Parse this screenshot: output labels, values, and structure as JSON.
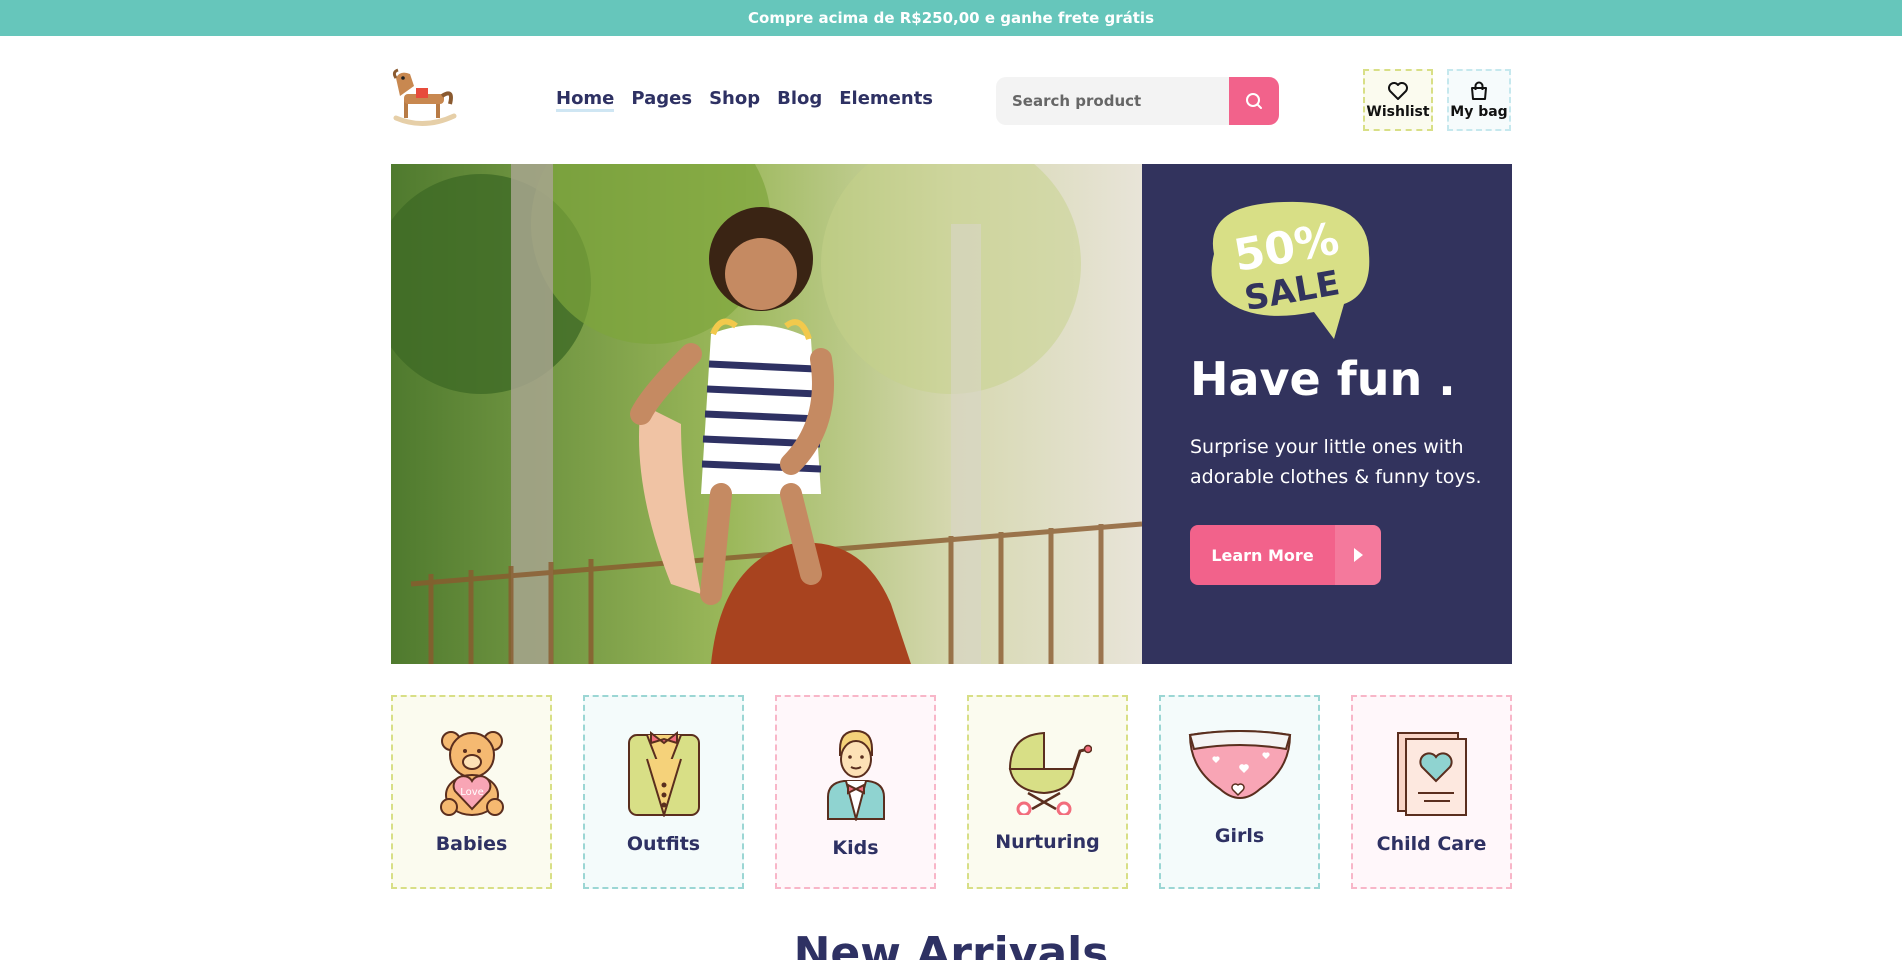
{
  "topbar": {
    "text": "Compre acima de R$250,00 e ganhe frete grátis"
  },
  "nav": {
    "items": [
      {
        "label": "Home"
      },
      {
        "label": "Pages"
      },
      {
        "label": "Shop"
      },
      {
        "label": "Blog"
      },
      {
        "label": "Elements"
      }
    ],
    "active": "Home"
  },
  "search": {
    "placeholder": "Search product"
  },
  "header_actions": {
    "wishlist": "Wishlist",
    "bag": "My bag"
  },
  "hero": {
    "badge_line1": "50%",
    "badge_line2": "SALE",
    "title": "Have fun .",
    "description": "Surprise your little ones with adorable clothes & funny toys.",
    "button": "Learn More"
  },
  "categories": [
    {
      "label": "Babies",
      "icon": "teddy-bear-icon",
      "badge": "Love"
    },
    {
      "label": "Outfits",
      "icon": "vest-icon"
    },
    {
      "label": "Kids",
      "icon": "boy-icon"
    },
    {
      "label": "Nurturing",
      "icon": "stroller-icon"
    },
    {
      "label": "Girls",
      "icon": "diaper-icon"
    },
    {
      "label": "Child Care",
      "icon": "card-icon"
    }
  ],
  "section_heading": "New Arrivals",
  "colors": {
    "teal": "#66c6bb",
    "pink": "#f2628b",
    "navy": "#32335d",
    "lime": "#d8df86"
  }
}
